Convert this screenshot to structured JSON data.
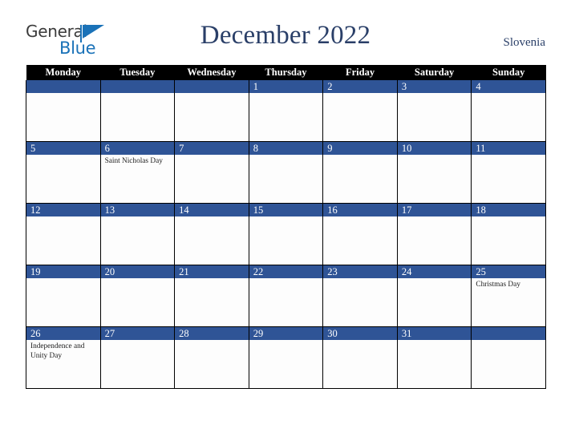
{
  "header": {
    "logo": {
      "part1": "General",
      "part2": "Blue",
      "triangle_color": "#1a72b8"
    },
    "title": "December 2022",
    "country": "Slovenia"
  },
  "calendar": {
    "weekday_headers": [
      "Monday",
      "Tuesday",
      "Wednesday",
      "Thursday",
      "Friday",
      "Saturday",
      "Sunday"
    ],
    "accent_color": "#2f5496",
    "header_bg": "#000000",
    "weeks": [
      [
        {
          "day": "",
          "events": []
        },
        {
          "day": "",
          "events": []
        },
        {
          "day": "",
          "events": []
        },
        {
          "day": "1",
          "events": []
        },
        {
          "day": "2",
          "events": []
        },
        {
          "day": "3",
          "events": []
        },
        {
          "day": "4",
          "events": []
        }
      ],
      [
        {
          "day": "5",
          "events": []
        },
        {
          "day": "6",
          "events": [
            "Saint Nicholas Day"
          ]
        },
        {
          "day": "7",
          "events": []
        },
        {
          "day": "8",
          "events": []
        },
        {
          "day": "9",
          "events": []
        },
        {
          "day": "10",
          "events": []
        },
        {
          "day": "11",
          "events": []
        }
      ],
      [
        {
          "day": "12",
          "events": []
        },
        {
          "day": "13",
          "events": []
        },
        {
          "day": "14",
          "events": []
        },
        {
          "day": "15",
          "events": []
        },
        {
          "day": "16",
          "events": []
        },
        {
          "day": "17",
          "events": []
        },
        {
          "day": "18",
          "events": []
        }
      ],
      [
        {
          "day": "19",
          "events": []
        },
        {
          "day": "20",
          "events": []
        },
        {
          "day": "21",
          "events": []
        },
        {
          "day": "22",
          "events": []
        },
        {
          "day": "23",
          "events": []
        },
        {
          "day": "24",
          "events": []
        },
        {
          "day": "25",
          "events": [
            "Christmas Day"
          ]
        }
      ],
      [
        {
          "day": "26",
          "events": [
            "Independence and Unity Day"
          ]
        },
        {
          "day": "27",
          "events": []
        },
        {
          "day": "28",
          "events": []
        },
        {
          "day": "29",
          "events": []
        },
        {
          "day": "30",
          "events": []
        },
        {
          "day": "31",
          "events": []
        },
        {
          "day": "",
          "events": []
        }
      ]
    ]
  }
}
